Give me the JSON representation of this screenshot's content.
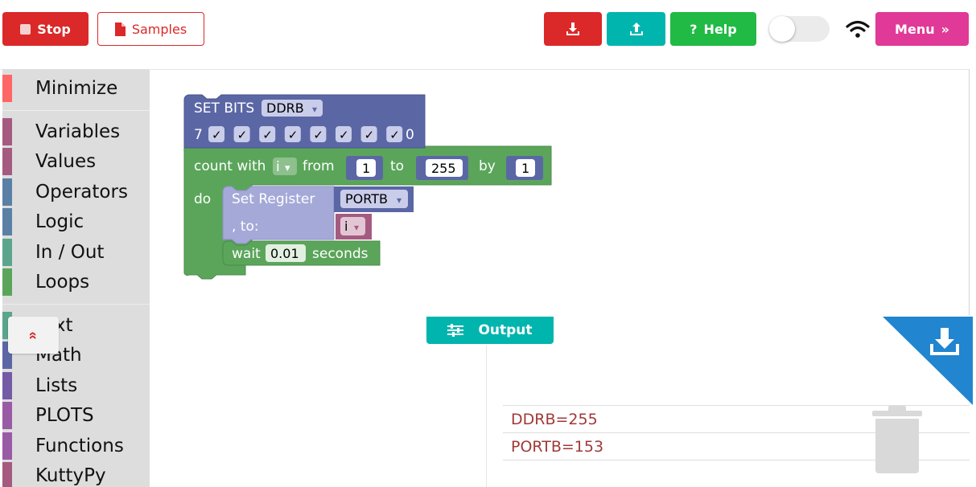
{
  "toolbar": {
    "stop_label": "Stop",
    "samples_label": "Samples",
    "help_label": "Help",
    "menu_label": "Menu",
    "help_glyph": "?",
    "menu_glyph": "»",
    "download_icon": "download-icon",
    "upload_icon": "upload-icon",
    "toggle_state": "off",
    "wifi_icon": "wifi-icon"
  },
  "toolbox": {
    "items": [
      {
        "label": "Minimize",
        "color": "#ff6666"
      },
      {
        "label": "Variables",
        "color": "#a55b80"
      },
      {
        "label": "Values",
        "color": "#a55b80"
      },
      {
        "label": "Operators",
        "color": "#5b80a5"
      },
      {
        "label": "Logic",
        "color": "#5b80a5"
      },
      {
        "label": "In / Out",
        "color": "#5ba58c"
      },
      {
        "label": "Loops",
        "color": "#5ba55b"
      },
      {
        "label": "Text",
        "color": "#5ba58c"
      },
      {
        "label": "Math",
        "color": "#5b67a5"
      },
      {
        "label": "Lists",
        "color": "#745ba5"
      },
      {
        "label": "PLOTS",
        "color": "#995ba5"
      },
      {
        "label": "Functions",
        "color": "#995ba5"
      },
      {
        "label": "KuttyPy",
        "color": "#a55b80"
      }
    ]
  },
  "blocks": {
    "set_bits": {
      "title": "SET BITS",
      "register": "DDRB",
      "high_bit": "7",
      "low_bit": "0",
      "checks": [
        "✓",
        "✓",
        "✓",
        "✓",
        "✓",
        "✓",
        "✓",
        "✓"
      ],
      "color": "#5b67a5"
    },
    "loop": {
      "count_with": "count with",
      "var": "i",
      "from_label": "from",
      "from": "1",
      "to_label": "to",
      "to": "255",
      "by_label": "by",
      "by": "1",
      "do_label": "do",
      "color": "#5ba55b"
    },
    "set_register": {
      "title": "Set Register",
      "to_label": ", to:",
      "register": "PORTB",
      "value_var": "i",
      "color": "#a5a9d8"
    },
    "wait": {
      "label": "wait",
      "value": "0.01",
      "unit": "seconds"
    },
    "dropdown_arrow": "▾"
  },
  "output": {
    "tab_label": "Output",
    "lines": [
      "DDRB=255",
      "PORTB=153"
    ],
    "text_color": "#9f3a38",
    "collapse_glyph": "«",
    "accent": "#2185d0"
  }
}
